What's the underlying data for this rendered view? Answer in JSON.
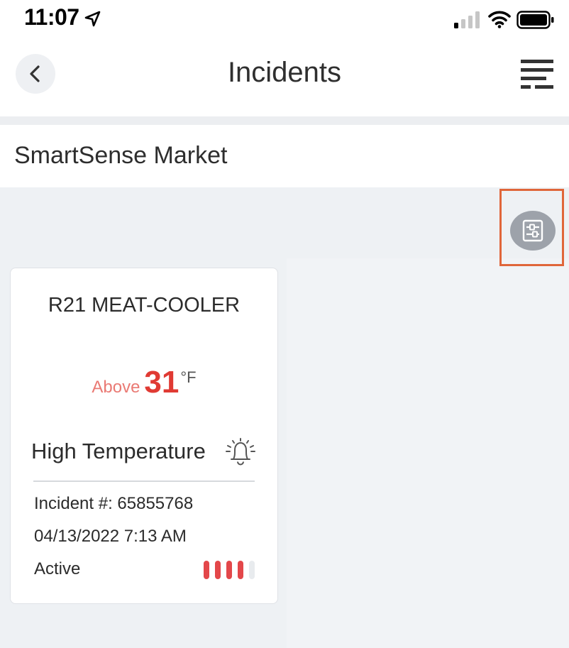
{
  "status_bar": {
    "time": "11:07",
    "icons": [
      "location-arrow-icon",
      "cellular-signal-icon",
      "wifi-icon",
      "battery-icon"
    ]
  },
  "nav": {
    "title": "Incidents",
    "back_icon": "chevron-left-icon",
    "menu_icon": "menu-icon"
  },
  "location": {
    "name": "SmartSense Market"
  },
  "toolbar": {
    "filter_icon": "filter-sliders-icon"
  },
  "incident_card": {
    "device": "R21 MEAT-COOLER",
    "reading_prefix": "Above",
    "reading_value": "31",
    "reading_unit": "°F",
    "alert_type": "High Temperature",
    "alert_icon": "bell-ringing-icon",
    "incident_number": "Incident #: 65855768",
    "datetime": "04/13/2022 7:13 AM",
    "status": "Active",
    "severity_level": 4,
    "severity_max": 5
  },
  "colors": {
    "accent_red": "#e03a33",
    "highlight_outline": "#e0663a",
    "background": "#eef1f4"
  }
}
